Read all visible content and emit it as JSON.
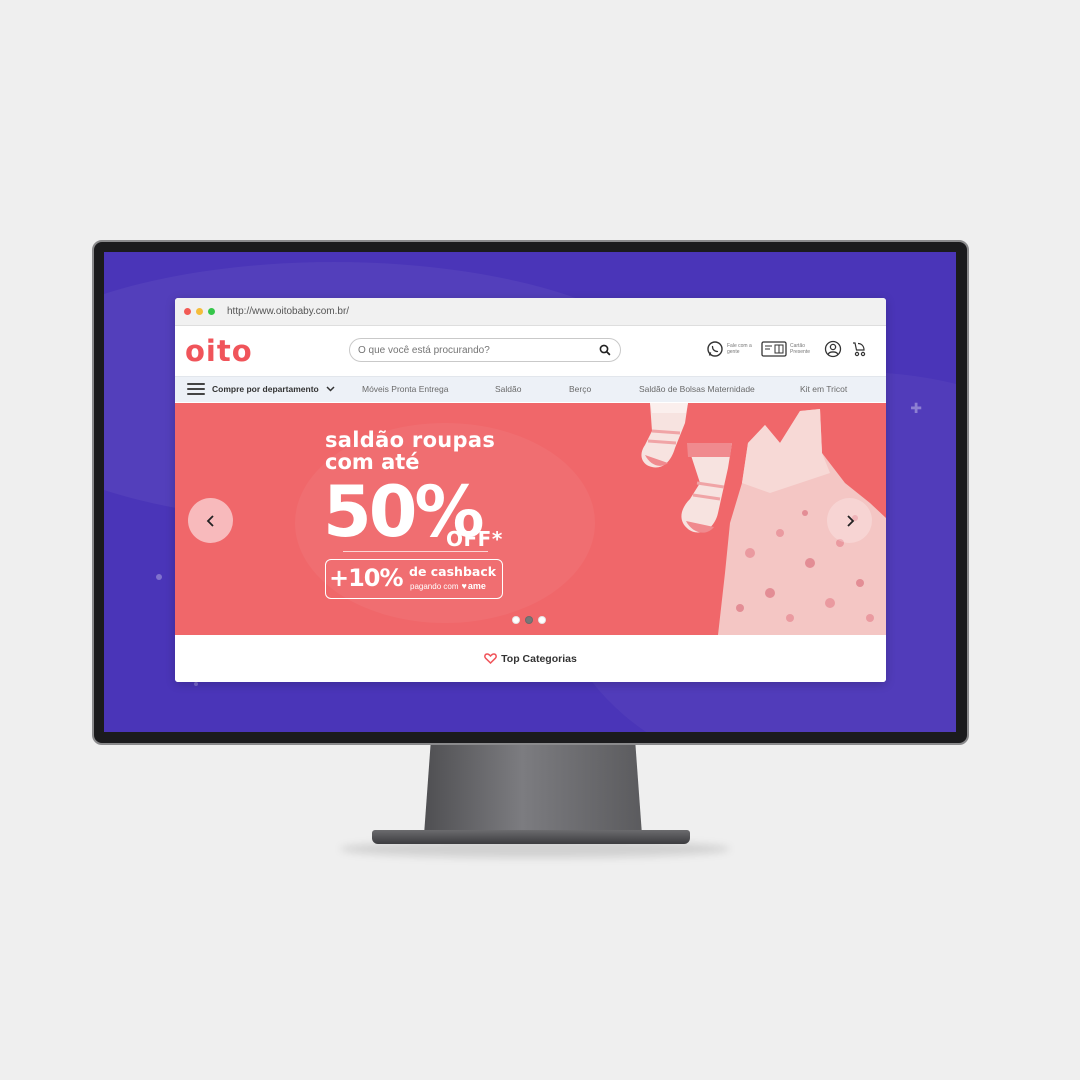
{
  "browser": {
    "url": "http://www.oitobaby.com.br/"
  },
  "header": {
    "logo": "oito",
    "search_placeholder": "O que você está procurando?",
    "contact_label": "Fale com a gente",
    "gift_card_label": "Cartão Presente"
  },
  "nav": {
    "department_label": "Compre por departamento",
    "links": [
      "Móveis Pronta Entrega",
      "Saldão",
      "Berço",
      "Saldão de Bolsas Maternidade",
      "Kit em Tricot"
    ]
  },
  "hero": {
    "line1": "saldão roupas",
    "line2": "com até",
    "percent": "50%",
    "off": "OFF*",
    "cashback_value": "+10%",
    "cashback_text": "de cashback",
    "cashback_pay": "pagando com",
    "cashback_brand": "ame",
    "slides": 3,
    "active_slide": 2
  },
  "section": {
    "top_categories": "Top Categorias"
  },
  "colors": {
    "brand": "#f0545a",
    "screen_bg": "#4a35b8",
    "hero_bg": "#f0676a",
    "nav_bg": "#edf1f7"
  },
  "icons": [
    "whatsapp-icon",
    "gift-card-icon",
    "user-icon",
    "stroller-icon",
    "search-icon",
    "menu-icon",
    "chevron-down-icon",
    "chevron-left-icon",
    "chevron-right-icon",
    "heart-icon"
  ]
}
